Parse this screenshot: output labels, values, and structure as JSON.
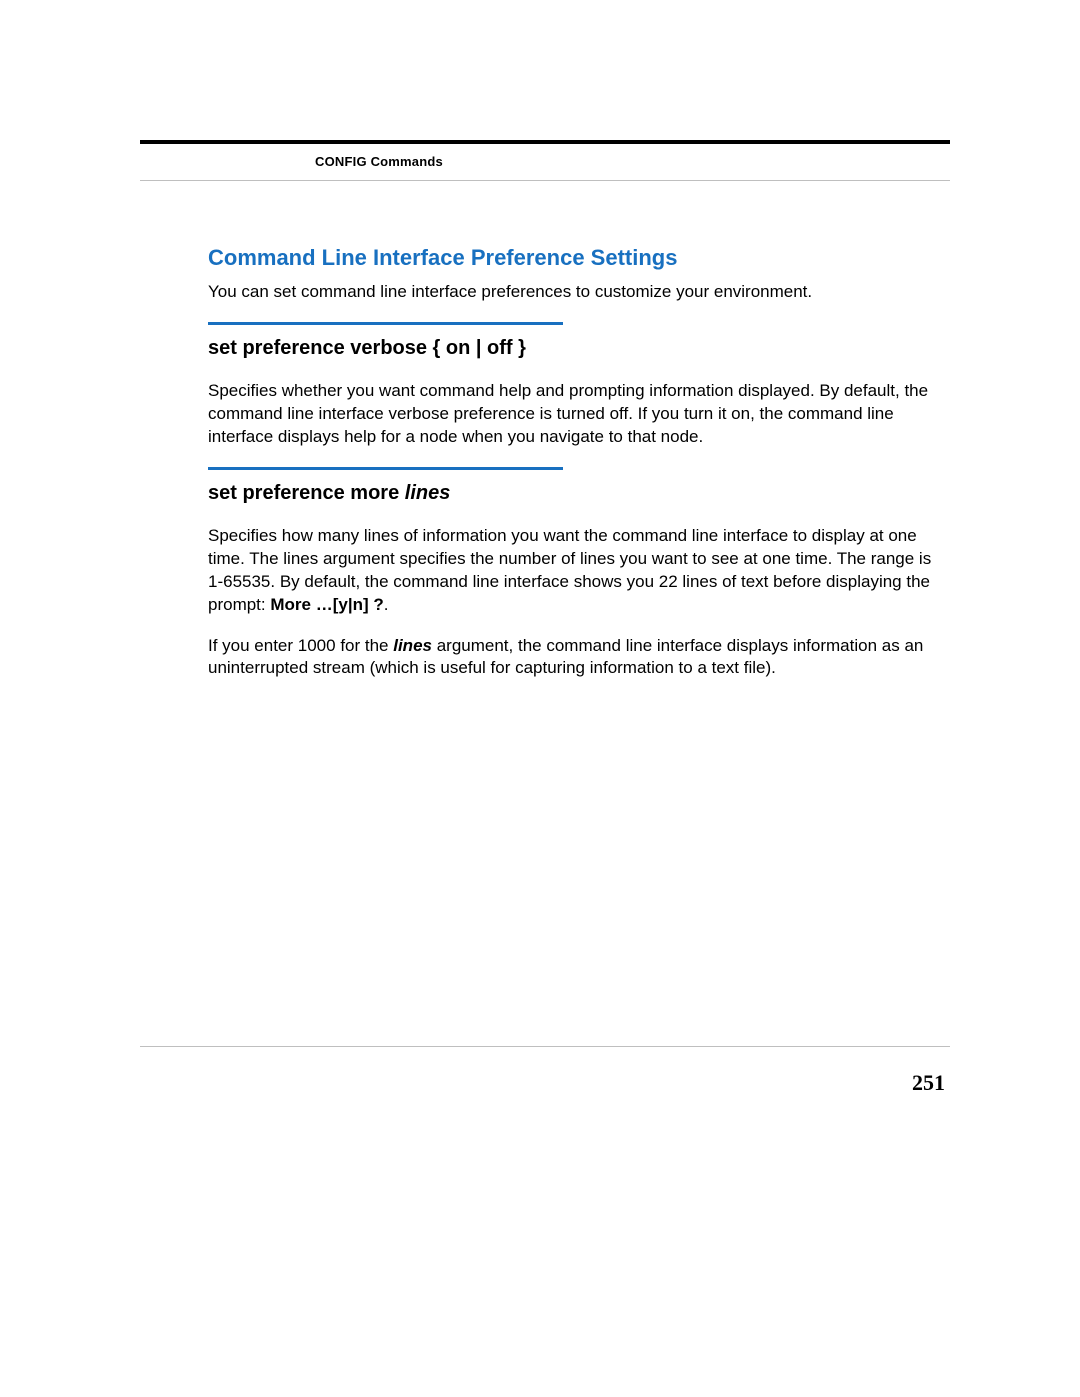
{
  "header": {
    "running_head": "CONFIG Commands"
  },
  "section": {
    "title": "Command Line Interface Preference Settings",
    "lead": "You can set command line interface preferences to customize your environment."
  },
  "cmd1": {
    "heading": "set preference verbose { on | off }",
    "para": "Specifies whether you want command help and prompting information displayed. By default, the command line interface verbose preference is turned off. If you turn it on, the command line interface displays help for a node when you navigate to that node."
  },
  "cmd2": {
    "heading_prefix": "set preference more ",
    "heading_arg": "lines",
    "para1_a": "Specifies how many lines of information you want the command line interface to display at one time. The lines argument specifies the number of lines you want to see at one time. The range is 1-65535. By default, the command line interface shows you 22 lines of text before displaying the prompt: ",
    "para1_bold": "More …[y|n] ?",
    "para1_c": ".",
    "para2_a": "If you enter 1000 for the ",
    "para2_arg": "lines",
    "para2_b": " argument, the command line interface displays information as an uninterrupted stream (which is useful for capturing information to a text file)."
  },
  "footer": {
    "page_number": "251"
  }
}
